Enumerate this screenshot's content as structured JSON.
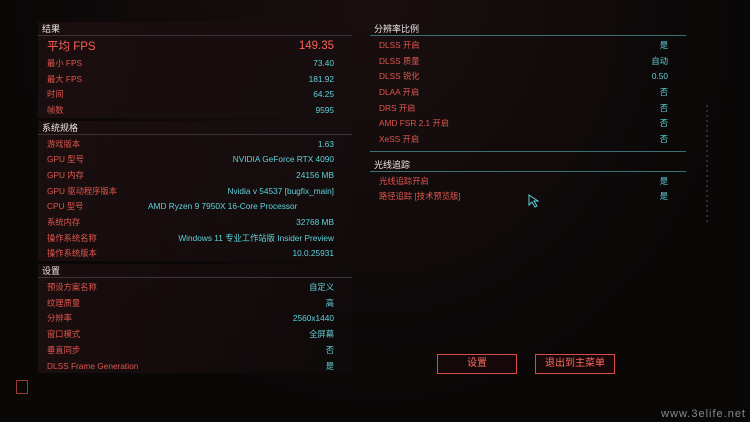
{
  "results": {
    "title": "结果",
    "avg_fps": {
      "label": "平均 FPS",
      "value": "149.35"
    },
    "min_fps": {
      "label": "最小 FPS",
      "value": "73.40"
    },
    "max_fps": {
      "label": "最大 FPS",
      "value": "181.92"
    },
    "time": {
      "label": "时间",
      "value": "64.25"
    },
    "frames": {
      "label": "帧数",
      "value": "9595"
    }
  },
  "specs": {
    "title": "系统规格",
    "rows": [
      {
        "label": "游戏版本",
        "value": "1.63"
      },
      {
        "label": "GPU 型号",
        "value": "NVIDIA GeForce RTX 4090"
      },
      {
        "label": "GPU 内存",
        "value": "24156 MB"
      },
      {
        "label": "GPU 驱动程序版本",
        "value": "Nvidia v 54537 [bugfix_main]"
      },
      {
        "label": "CPU 型号",
        "value": "AMD Ryzen 9 7950X 16-Core Processor"
      },
      {
        "label": "系统内存",
        "value": "32768 MB"
      },
      {
        "label": "操作系统名称",
        "value": "Windows 11 专业工作站版 Insider Preview"
      },
      {
        "label": "操作系统版本",
        "value": "10.0.25931"
      }
    ]
  },
  "settings": {
    "title": "设置",
    "rows": [
      {
        "label": "预设方案名称",
        "value": "自定义"
      },
      {
        "label": "纹理质量",
        "value": "高"
      },
      {
        "label": "分辨率",
        "value": "2560x1440"
      },
      {
        "label": "窗口模式",
        "value": "全屏幕"
      },
      {
        "label": "垂直同步",
        "value": "否"
      },
      {
        "label": "DLSS Frame Generation",
        "value": "是"
      }
    ]
  },
  "resolution_scaling": {
    "title": "分辨率比例",
    "rows": [
      {
        "label": "DLSS 开启",
        "value": "是"
      },
      {
        "label": "DLSS 质量",
        "value": "自动"
      },
      {
        "label": "DLSS 锐化",
        "value": "0.50"
      },
      {
        "label": "DLAA 开启",
        "value": "否"
      },
      {
        "label": "DRS 开启",
        "value": "否"
      },
      {
        "label": "AMD FSR 2.1 开启",
        "value": "否"
      },
      {
        "label": "XeSS 开启",
        "value": "否"
      }
    ]
  },
  "raytracing": {
    "title": "光线追踪",
    "rows": [
      {
        "label": "光线追踪开启",
        "value": "是"
      },
      {
        "label": "路径追踪 [技术预览版]",
        "value": "是"
      }
    ]
  },
  "buttons": {
    "settings": "设置",
    "exit": "退出到主菜单"
  },
  "watermark": "www.3elife.net",
  "colors": {
    "accent": "#e25a54",
    "value": "#5fd4dc",
    "button_border": "#d94b45"
  }
}
